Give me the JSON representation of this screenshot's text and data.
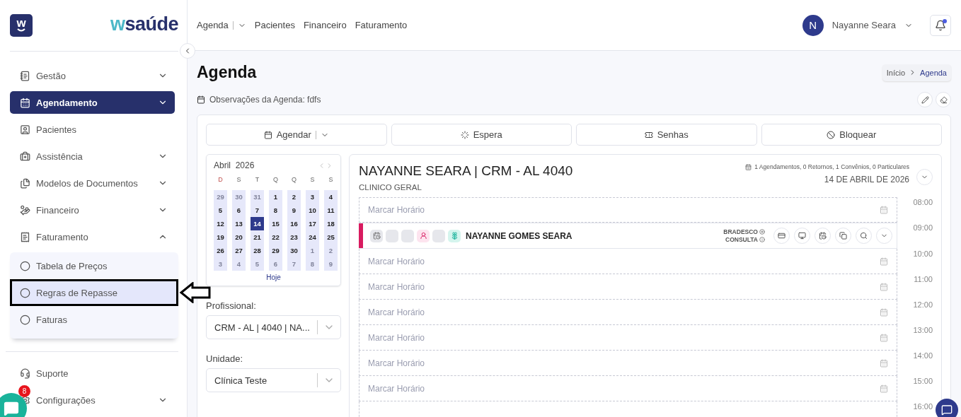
{
  "brand": {
    "mark": "w",
    "accent": "w",
    "rest": "saúde"
  },
  "sidebar": {
    "items": [
      {
        "label": "Gestão",
        "kind": "group",
        "selected": false,
        "expanded": false
      },
      {
        "label": "Agendamento",
        "kind": "group",
        "selected": true,
        "expanded": false
      },
      {
        "label": "Pacientes",
        "kind": "link",
        "selected": false
      },
      {
        "label": "Assistência",
        "kind": "group",
        "selected": false,
        "expanded": false
      },
      {
        "label": "Modelos de Documentos",
        "kind": "group",
        "selected": false,
        "expanded": false
      },
      {
        "label": "Financeiro",
        "kind": "group",
        "selected": false,
        "expanded": false
      },
      {
        "label": "Faturamento",
        "kind": "group",
        "selected": false,
        "expanded": true,
        "children": [
          {
            "label": "Tabela de Preços",
            "selected": false,
            "highlighted": false
          },
          {
            "label": "Regras de Repasse",
            "selected": true,
            "highlighted": true
          },
          {
            "label": "Faturas",
            "selected": false,
            "highlighted": false
          }
        ]
      }
    ],
    "footer_items": [
      {
        "label": "Suporte",
        "kind": "link",
        "selected": false
      },
      {
        "label": "Configurações",
        "kind": "group",
        "selected": false,
        "expanded": false
      }
    ]
  },
  "chat_widget": {
    "badge": "8"
  },
  "topnav": [
    {
      "label": "Agenda",
      "dropdown": true
    },
    {
      "label": "Pacientes",
      "dropdown": false
    },
    {
      "label": "Financeiro",
      "dropdown": false
    },
    {
      "label": "Faturamento",
      "dropdown": false
    }
  ],
  "user": {
    "initial": "N",
    "name": "Nayanne Seara",
    "unread": true
  },
  "page": {
    "title": "Agenda",
    "breadcrumb": [
      {
        "label": "Início",
        "selected": false
      },
      {
        "label": "Agenda",
        "selected": true
      }
    ],
    "notes": "Observações da Agenda: fdfs"
  },
  "actions": [
    {
      "label": "Agendar",
      "dropdown": true
    },
    {
      "label": "Espera",
      "dropdown": false
    },
    {
      "label": "Senhas",
      "dropdown": false
    },
    {
      "label": "Bloquear",
      "dropdown": false
    }
  ],
  "calendar": {
    "month": "Abril",
    "year": "2026",
    "weekdays": [
      "D",
      "S",
      "T",
      "Q",
      "Q",
      "S",
      "S"
    ],
    "weeks": [
      [
        {
          "day": "29",
          "outside": true,
          "selected": false
        },
        {
          "day": "30",
          "outside": true,
          "selected": false
        },
        {
          "day": "31",
          "outside": true,
          "selected": false
        },
        {
          "day": "1",
          "outside": false,
          "selected": false
        },
        {
          "day": "2",
          "outside": false,
          "selected": false
        },
        {
          "day": "3",
          "outside": false,
          "selected": false
        },
        {
          "day": "4",
          "outside": false,
          "selected": false
        }
      ],
      [
        {
          "day": "5",
          "outside": false,
          "selected": false
        },
        {
          "day": "6",
          "outside": false,
          "selected": false
        },
        {
          "day": "7",
          "outside": false,
          "selected": false
        },
        {
          "day": "8",
          "outside": false,
          "selected": false
        },
        {
          "day": "9",
          "outside": false,
          "selected": false
        },
        {
          "day": "10",
          "outside": false,
          "selected": false
        },
        {
          "day": "11",
          "outside": false,
          "selected": false
        }
      ],
      [
        {
          "day": "12",
          "outside": false,
          "selected": false
        },
        {
          "day": "13",
          "outside": false,
          "selected": false
        },
        {
          "day": "14",
          "outside": false,
          "selected": true
        },
        {
          "day": "15",
          "outside": false,
          "selected": false
        },
        {
          "day": "16",
          "outside": false,
          "selected": false
        },
        {
          "day": "17",
          "outside": false,
          "selected": false
        },
        {
          "day": "18",
          "outside": false,
          "selected": false
        }
      ],
      [
        {
          "day": "19",
          "outside": false,
          "selected": false
        },
        {
          "day": "20",
          "outside": false,
          "selected": false
        },
        {
          "day": "21",
          "outside": false,
          "selected": false
        },
        {
          "day": "22",
          "outside": false,
          "selected": false
        },
        {
          "day": "23",
          "outside": false,
          "selected": false
        },
        {
          "day": "24",
          "outside": false,
          "selected": false
        },
        {
          "day": "25",
          "outside": false,
          "selected": false
        }
      ],
      [
        {
          "day": "26",
          "outside": false,
          "selected": false
        },
        {
          "day": "27",
          "outside": false,
          "selected": false
        },
        {
          "day": "28",
          "outside": false,
          "selected": false
        },
        {
          "day": "29",
          "outside": false,
          "selected": false
        },
        {
          "day": "30",
          "outside": false,
          "selected": false
        },
        {
          "day": "1",
          "outside": true,
          "selected": false
        },
        {
          "day": "2",
          "outside": true,
          "selected": false
        }
      ],
      [
        {
          "day": "3",
          "outside": true,
          "selected": false
        },
        {
          "day": "4",
          "outside": true,
          "selected": false
        },
        {
          "day": "5",
          "outside": true,
          "selected": false
        },
        {
          "day": "6",
          "outside": true,
          "selected": false
        },
        {
          "day": "7",
          "outside": true,
          "selected": false
        },
        {
          "day": "8",
          "outside": true,
          "selected": false
        },
        {
          "day": "9",
          "outside": true,
          "selected": false
        }
      ]
    ],
    "today": "Hoje"
  },
  "filters": [
    {
      "label": "Profissional:",
      "value": "CRM - AL | 4040 | NA..."
    },
    {
      "label": "Unidade:",
      "value": "Clínica Teste"
    }
  ],
  "schedule": {
    "doctor": "NAYANNE SEARA | CRM - AL 4040",
    "specialty": "CLINICO GERAL",
    "summary": "1 Agendamentos, 0 Retornos, 1 Convênios, 0 Particulares",
    "date": "14 DE ABRIL DE 2026",
    "slots": [
      {
        "kind": "empty",
        "time": "08:00",
        "text": "Marcar Horário"
      },
      {
        "kind": "appointment",
        "time": "09:00",
        "patient": "NAYANNE GOMES SEARA",
        "insurance": "BRADESCO",
        "type": "CONSULTA",
        "color": "#d81b60"
      },
      {
        "kind": "empty",
        "time": "10:00",
        "text": "Marcar Horário"
      },
      {
        "kind": "empty",
        "time": "11:00",
        "text": "Marcar Horário"
      },
      {
        "kind": "empty",
        "time": "12:00",
        "text": "Marcar Horário"
      },
      {
        "kind": "empty",
        "time": "13:00",
        "text": "Marcar Horário"
      },
      {
        "kind": "empty",
        "time": "14:00",
        "text": "Marcar Horário"
      },
      {
        "kind": "empty",
        "time": "15:00",
        "text": "Marcar Horário"
      },
      {
        "kind": "blank",
        "time": "16:00"
      }
    ]
  }
}
